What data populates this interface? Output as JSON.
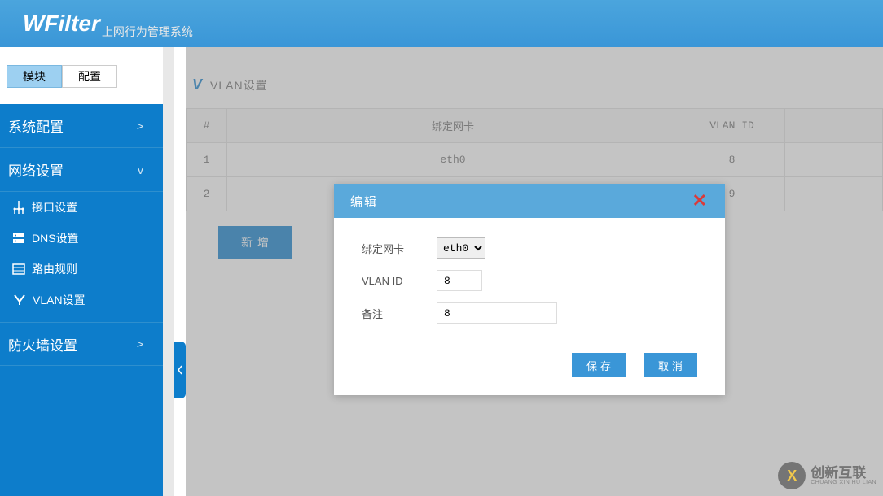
{
  "header": {
    "title": "WFilter",
    "subtitle": "上网行为管理系统"
  },
  "sidebar": {
    "tabs": [
      {
        "label": "模块",
        "active": true
      },
      {
        "label": "配置",
        "active": false
      }
    ],
    "sections": [
      {
        "label": "系统配置",
        "expanded": false,
        "chevron": ">"
      },
      {
        "label": "网络设置",
        "expanded": true,
        "chevron": "v",
        "items": [
          {
            "label": "接口设置",
            "icon": "interface"
          },
          {
            "label": "DNS设置",
            "icon": "dns"
          },
          {
            "label": "路由规则",
            "icon": "route"
          },
          {
            "label": "VLAN设置",
            "icon": "vlan",
            "active": true
          }
        ]
      },
      {
        "label": "防火墙设置",
        "expanded": false,
        "chevron": ">"
      }
    ]
  },
  "page": {
    "title": "VLAN设置",
    "icon": "V"
  },
  "table": {
    "headers": {
      "num": "#",
      "nic": "绑定网卡",
      "vlan": "VLAN ID"
    },
    "rows": [
      {
        "num": "1",
        "nic": "eth0",
        "vlan": "8"
      },
      {
        "num": "2",
        "nic": "",
        "vlan": "9"
      }
    ]
  },
  "buttons": {
    "add": "新增",
    "save": "保存",
    "cancel": "取消"
  },
  "modal": {
    "title": "编辑",
    "fields": {
      "nic_label": "绑定网卡",
      "nic_value": "eth0",
      "vlan_label": "VLAN ID",
      "vlan_value": "8",
      "remark_label": "备注",
      "remark_value": "8"
    }
  },
  "footer": {
    "logo_letter": "X",
    "brand_cn": "创新互联",
    "brand_en": "CHUANG XIN HU LIAN"
  }
}
